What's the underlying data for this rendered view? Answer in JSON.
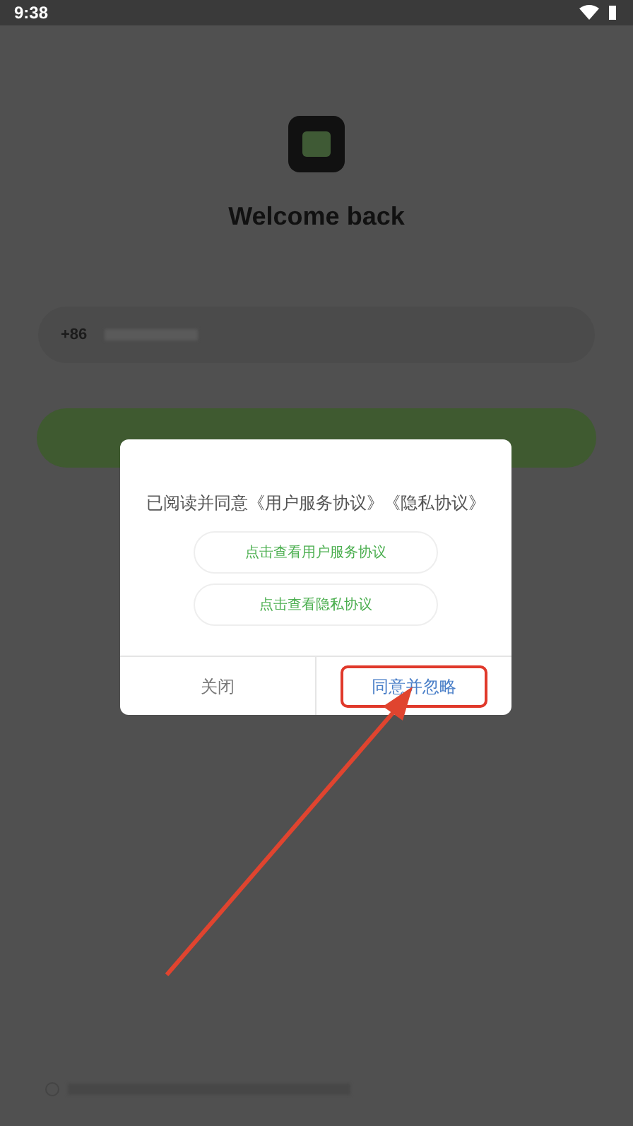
{
  "status_bar": {
    "time": "9:38"
  },
  "login": {
    "title": "Welcome back",
    "country_code": "+86",
    "agree_checked": false
  },
  "dialog": {
    "message": "已阅读并同意《用户服务协议》《隐私协议》",
    "links": [
      "点击查看用户服务协议",
      "点击查看隐私协议"
    ],
    "buttons": [
      {
        "label": "关闭",
        "kind": "cancel",
        "highlighted": false
      },
      {
        "label": "同意并忽略",
        "kind": "confirm",
        "highlighted": true
      }
    ]
  }
}
